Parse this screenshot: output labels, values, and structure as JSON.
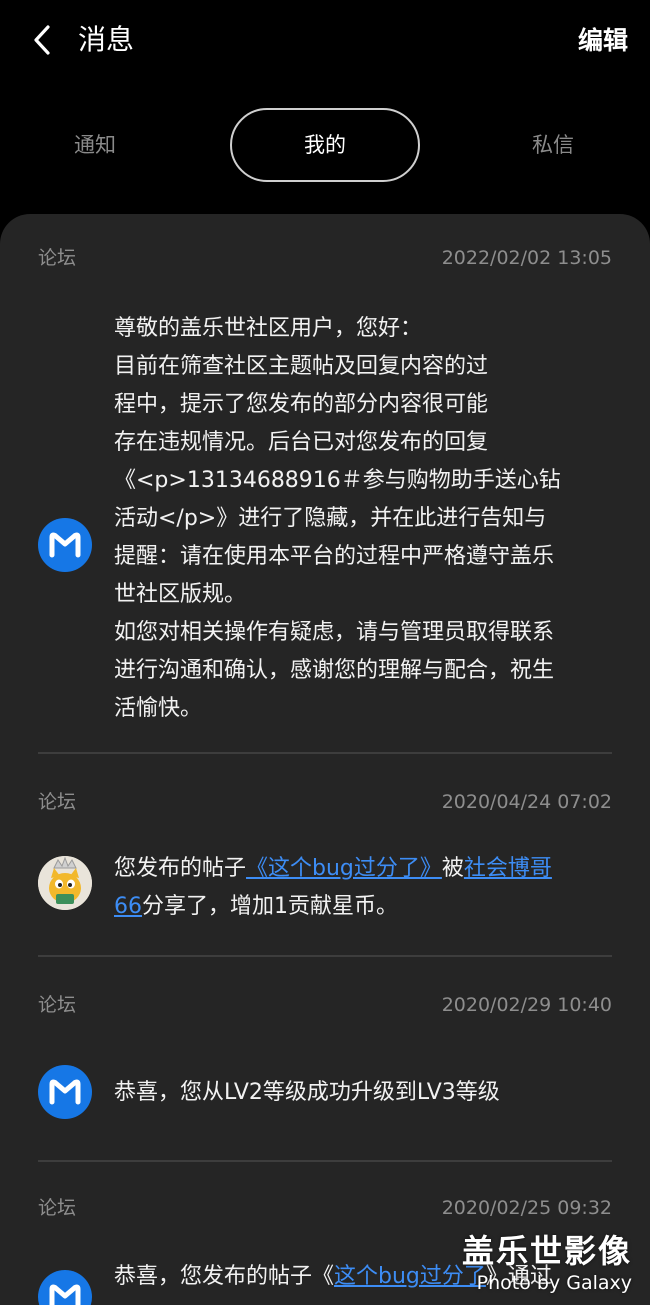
{
  "header": {
    "title": "消息",
    "edit_label": "编辑"
  },
  "tabs": [
    {
      "label": "通知",
      "selected": false
    },
    {
      "label": "我的",
      "selected": true
    },
    {
      "label": "私信",
      "selected": false
    }
  ],
  "messages": [
    {
      "source": "论坛",
      "time": "2022/02/02 13:05",
      "avatar": "m-logo-icon",
      "lines": [
        "尊敬的盖乐世社区用户，您好：",
        "目前在筛查社区主题帖及回复内容的过",
        "程中，提示了您发布的部分内容很可能",
        "存在违规情况。后台已对您发布的回复",
        "《<p>13134688916＃参与购物助手送心钻",
        "活动</p>》进行了隐藏，并在此进行告知与",
        "提醒：请在使用本平台的过程中严格遵守盖乐",
        "世社区版规。",
        "如您对相关操作有疑虑，请与管理员取得联系",
        "进行沟通和确认，感谢您的理解与配合，祝生",
        "活愉快。"
      ]
    },
    {
      "source": "论坛",
      "time": "2020/04/24 07:02",
      "avatar": "cat-crown-avatar",
      "text_a": "您发布的帖子",
      "link_post": "《这个bug过分了》",
      "text_b": "被",
      "link_user_1": "社会博哥",
      "link_user_2": "66",
      "text_c": "分享了，增加1贡献星币。"
    },
    {
      "source": "论坛",
      "time": "2020/02/29 10:40",
      "avatar": "m-logo-icon",
      "text": "恭喜，您从LV2等级成功升级到LV3等级"
    },
    {
      "source": "论坛",
      "time": "2020/02/25 09:32",
      "avatar": "m-logo-icon",
      "text_a": "恭喜，您发布的帖子《",
      "link_post": "这个bug过分了",
      "text_b": "》通过"
    }
  ],
  "watermark": {
    "main": "盖乐世影像",
    "sub": "Photo by Galaxy"
  },
  "colors": {
    "background": "#000000",
    "card": "#252525",
    "link": "#3d8df5",
    "avatar_blue": "#1677e6",
    "muted_text": "#8e8e8e"
  }
}
